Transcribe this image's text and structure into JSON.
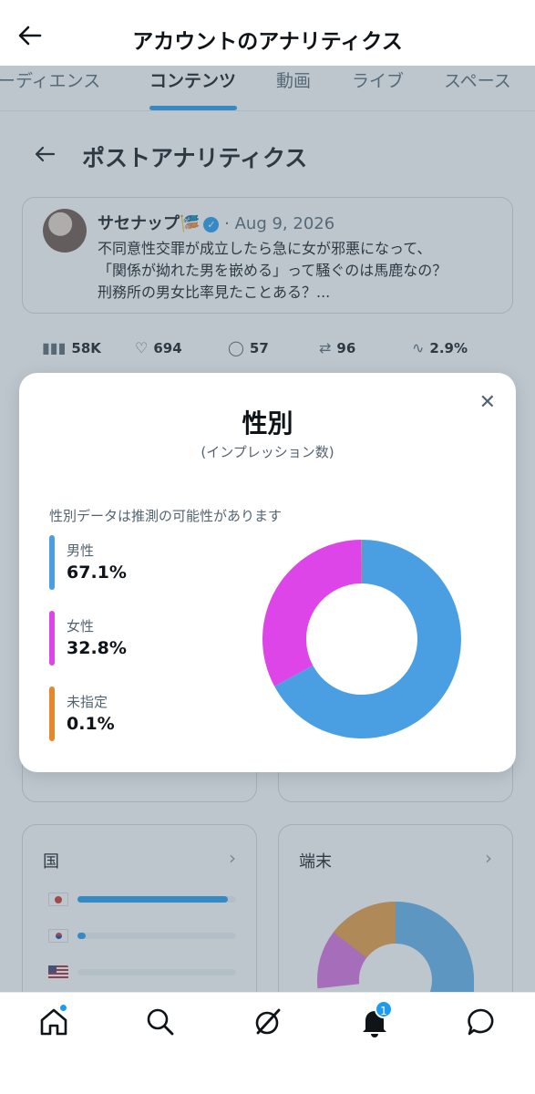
{
  "header": {
    "title": "アカウントのアナリティクス"
  },
  "tabs": [
    {
      "label": "ーディエンス"
    },
    {
      "label": "コンテンツ",
      "active": true
    },
    {
      "label": "動画"
    },
    {
      "label": "ライブ"
    },
    {
      "label": "スペース"
    }
  ],
  "post_section": {
    "heading": "ポストアナリティクス"
  },
  "post": {
    "author": "サセナップ",
    "author_emoji": "🎏",
    "date": "· Aug 9, 2026",
    "text_lines": [
      "不同意性交罪が成立したら急に女が邪悪になって、",
      "「関係が拗れた男を嵌める」って騒ぐのは馬鹿なの？",
      "刑務所の男女比率見たことある？..."
    ]
  },
  "metrics": {
    "views": "58K",
    "likes": "694",
    "replies": "57",
    "reposts": "96",
    "engagement": "2.9%"
  },
  "country_card": {
    "title": "国",
    "bars": [
      0.95,
      0.05,
      0.0
    ]
  },
  "device_card": {
    "title": "端末"
  },
  "modal": {
    "title": "性別",
    "subtitle": "(インプレッション数)",
    "note": "性別データは推測の可能性があります",
    "legend": [
      {
        "label": "男性",
        "value": "67.1%",
        "color": "#4a9fe3"
      },
      {
        "label": "女性",
        "value": "32.8%",
        "color": "#dd45e8"
      },
      {
        "label": "未指定",
        "value": "0.1%",
        "color": "#e3892b"
      }
    ]
  },
  "chart_data": {
    "type": "pie",
    "title": "性別",
    "subtitle": "(インプレッション数)",
    "categories": [
      "男性",
      "女性",
      "未指定"
    ],
    "values": [
      67.1,
      32.8,
      0.1
    ],
    "colors": [
      "#4a9fe3",
      "#dd45e8",
      "#e3892b"
    ]
  },
  "bottom_nav": {
    "notification_count": "1"
  }
}
